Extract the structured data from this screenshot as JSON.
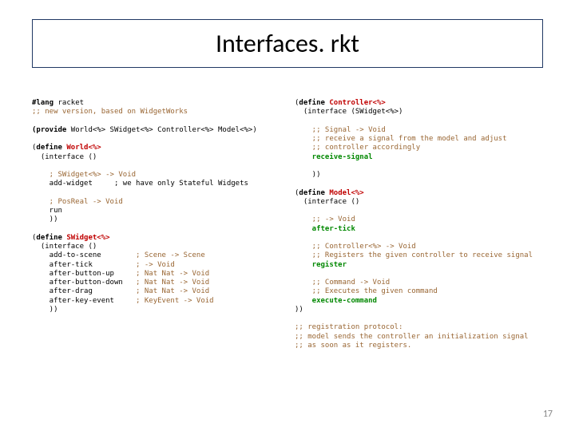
{
  "title": "Interfaces. rkt",
  "pageNumber": "17",
  "left": {
    "l01a": "#lang",
    "l01b": "racket",
    "l02": ";; new version, based on WidgetWorks",
    "l03a": "(provide",
    "l03b": " World<%> SWidget<%> Controller<%> Model<%>)",
    "l04a": "(",
    "l04b": "define",
    "l04c": " ",
    "l04d": "World<%>",
    "l05": "  (interface ()",
    "l06": "    ; SWidget<%> -> Void",
    "l06b": " ",
    "l07": "    add-widget     ; we have only Stateful Widgets",
    "l08": "    ; PosReal -> Void",
    "l08b": " ",
    "l09": "    run",
    "l10": "    ))",
    "l11a": "(",
    "l11b": "define",
    "l11c": " ",
    "l11d": "SWidget<%>",
    "l12": "  (interface ()",
    "l13a": "    add-to-scene        ",
    "l13b": "; Scene -> Scene",
    "l14a": "    after-tick          ",
    "l14b": "; -> Void",
    "l15a": "    after-button-up     ",
    "l15b": "; Nat Nat -> Void",
    "l16a": "    after-button-down   ",
    "l16b": "; Nat Nat -> Void",
    "l17a": "    after-drag          ",
    "l17b": "; Nat Nat -> Void",
    "l18a": "    after-key-event     ",
    "l18b": "; KeyEvent -> Void",
    "l19": "    ))"
  },
  "right": {
    "r01a": "(",
    "r01b": "define",
    "r01c": " ",
    "r01d": "Controller<%>",
    "r02": "  (interface (SWidget<%>)",
    "r03": "    ;; Signal -> Void",
    "r04": "    ;; receive a signal from the model and adjust",
    "r05": "    ;; controller accordingly",
    "r06": "    receive-signal",
    "r07": "    ))",
    "r08a": "(",
    "r08b": "define",
    "r08c": " ",
    "r08d": "Model<%>",
    "r09": "  (interface ()",
    "r10": "    ;; -> Void",
    "r11": "    after-tick",
    "r12": "    ;; Controller<%> -> Void",
    "r13": "    ;; Registers the given controller to receive signal",
    "r14": "    register",
    "r15": "    ;; Command -> Void",
    "r16": "    ;; Executes the given command",
    "r17": "    execute-command",
    "r18": "))",
    "r19": ";; registration protocol:",
    "r20": ";; model sends the controller an initialization signal",
    "r21": ";; as soon as it registers."
  }
}
